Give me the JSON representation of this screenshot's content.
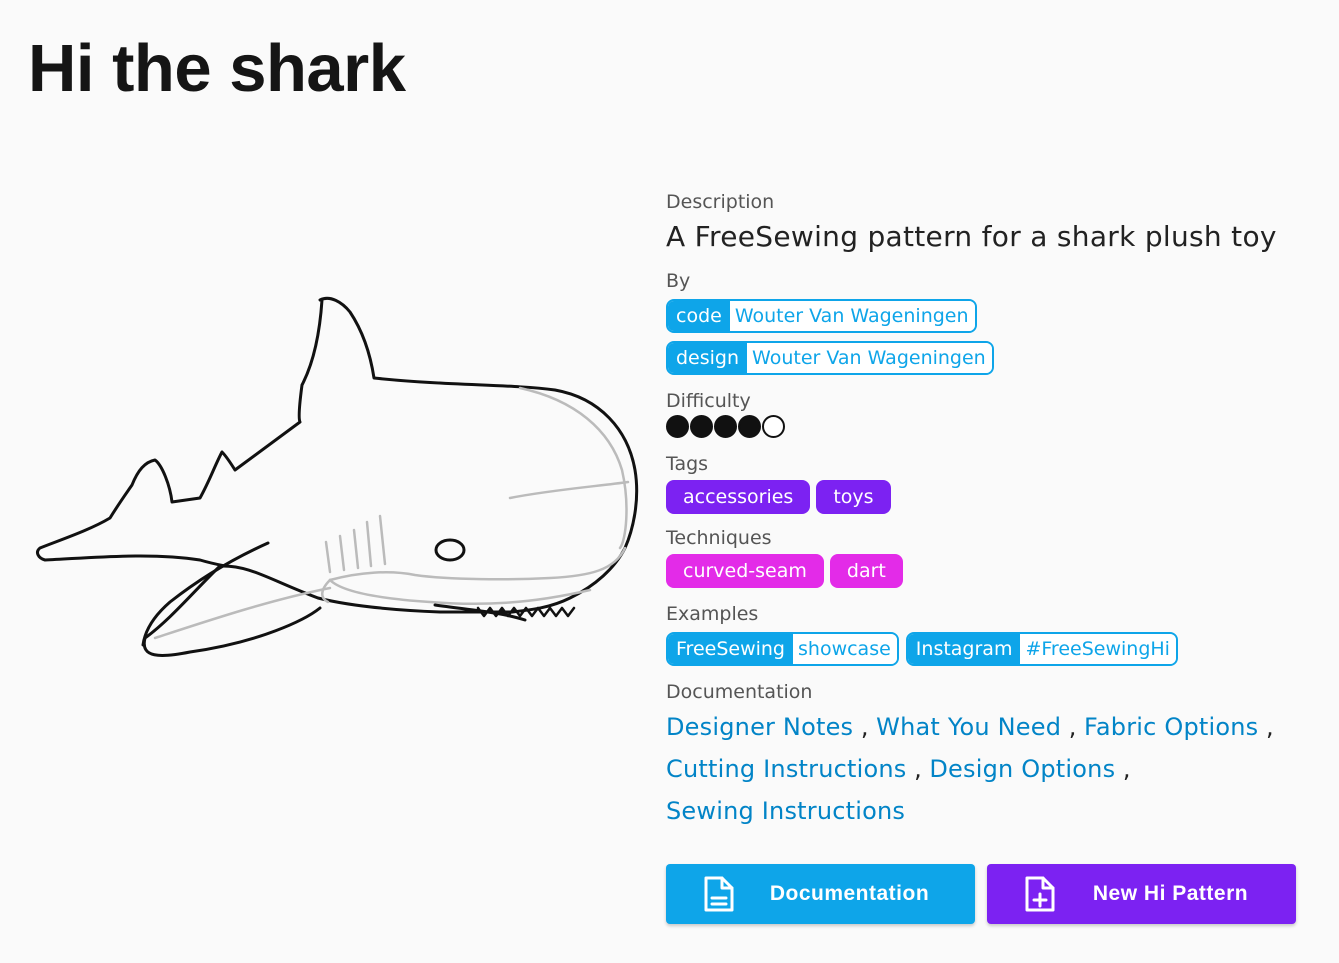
{
  "title": "Hi the shark",
  "description": {
    "label": "Description",
    "text": "A FreeSewing pattern for a shark plush toy"
  },
  "by": {
    "label": "By",
    "items": [
      {
        "role": "code",
        "name": "Wouter Van Wageningen"
      },
      {
        "role": "design",
        "name": "Wouter Van Wageningen"
      }
    ]
  },
  "difficulty": {
    "label": "Difficulty",
    "level": 4,
    "max": 5
  },
  "tags": {
    "label": "Tags",
    "items": [
      "accessories",
      "toys"
    ]
  },
  "techniques": {
    "label": "Techniques",
    "items": [
      "curved-seam",
      "dart"
    ]
  },
  "examples": {
    "label": "Examples",
    "items": [
      {
        "source": "FreeSewing",
        "value": "showcase"
      },
      {
        "source": "Instagram",
        "value": "#FreeSewingHi"
      }
    ]
  },
  "documentation": {
    "label": "Documentation",
    "links": [
      "Designer Notes",
      "What You Need",
      "Fabric Options",
      "Cutting Instructions",
      "Design Options",
      "Sewing Instructions"
    ]
  },
  "buttons": {
    "documentation": "Documentation",
    "new_pattern": "New Hi Pattern"
  },
  "colors": {
    "accent_blue": "#0ea5e9",
    "accent_purple": "#7c22f2",
    "accent_pink": "#e32be8",
    "link": "#0284c7"
  }
}
